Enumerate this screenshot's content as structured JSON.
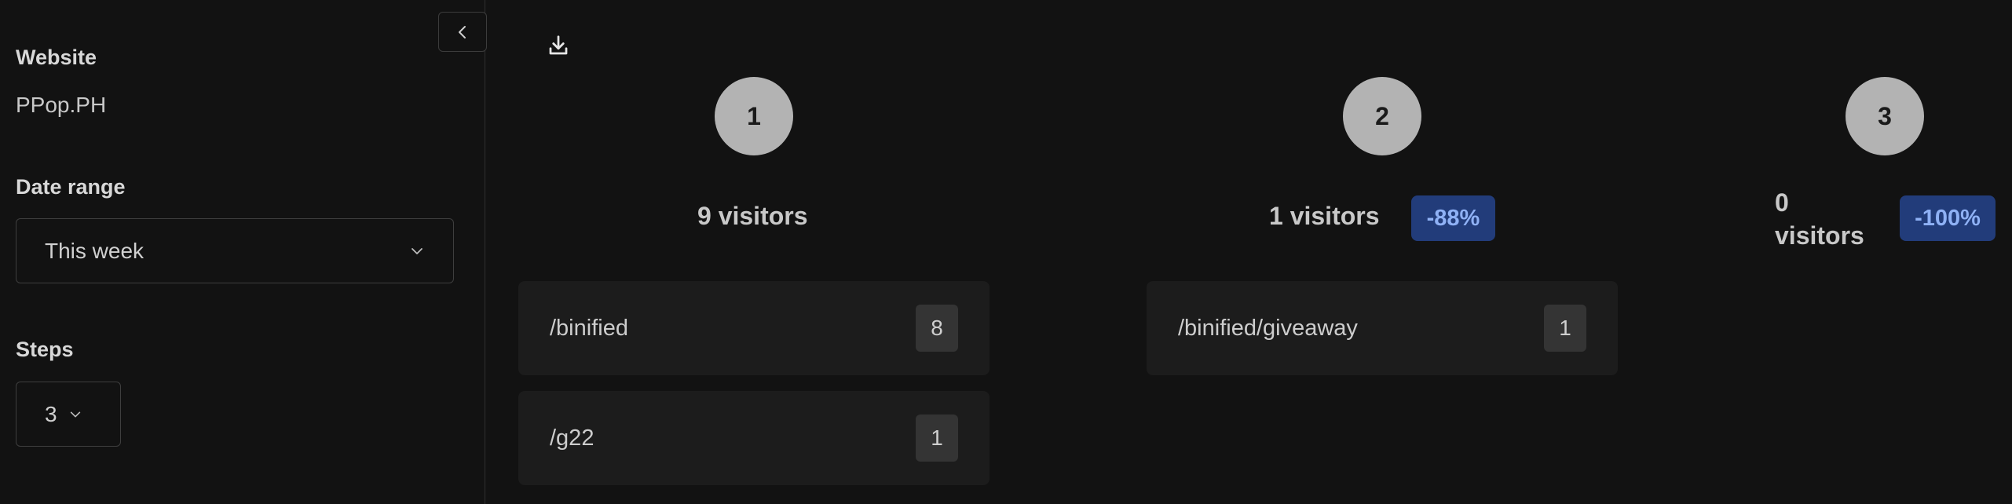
{
  "sidebar": {
    "website_label": "Website",
    "website_value": "PPop.PH",
    "date_range_label": "Date range",
    "date_range_value": "This week",
    "steps_label": "Steps",
    "steps_value": "3"
  },
  "funnel": {
    "steps": [
      {
        "number": "1",
        "visitors": "9 visitors",
        "badge": "",
        "pages": [
          {
            "path": "/binified",
            "count": "8"
          },
          {
            "path": "/g22",
            "count": "1"
          }
        ]
      },
      {
        "number": "2",
        "visitors": "1 visitors",
        "badge": "-88%",
        "pages": [
          {
            "path": "/binified/giveaway",
            "count": "1"
          }
        ]
      },
      {
        "number": "3",
        "visitors_count": "0",
        "visitors_word": "visitors",
        "badge": "-100%",
        "pages": []
      }
    ]
  },
  "colors": {
    "background": "#121212",
    "card": "#1c1c1c",
    "step_circle": "#b3b3b3",
    "badge_bg": "#223c7a",
    "badge_text": "#8fb1f5"
  },
  "icons": {
    "collapse": "chevron-left-icon",
    "download": "download-icon",
    "select": "chevron-down-icon"
  }
}
